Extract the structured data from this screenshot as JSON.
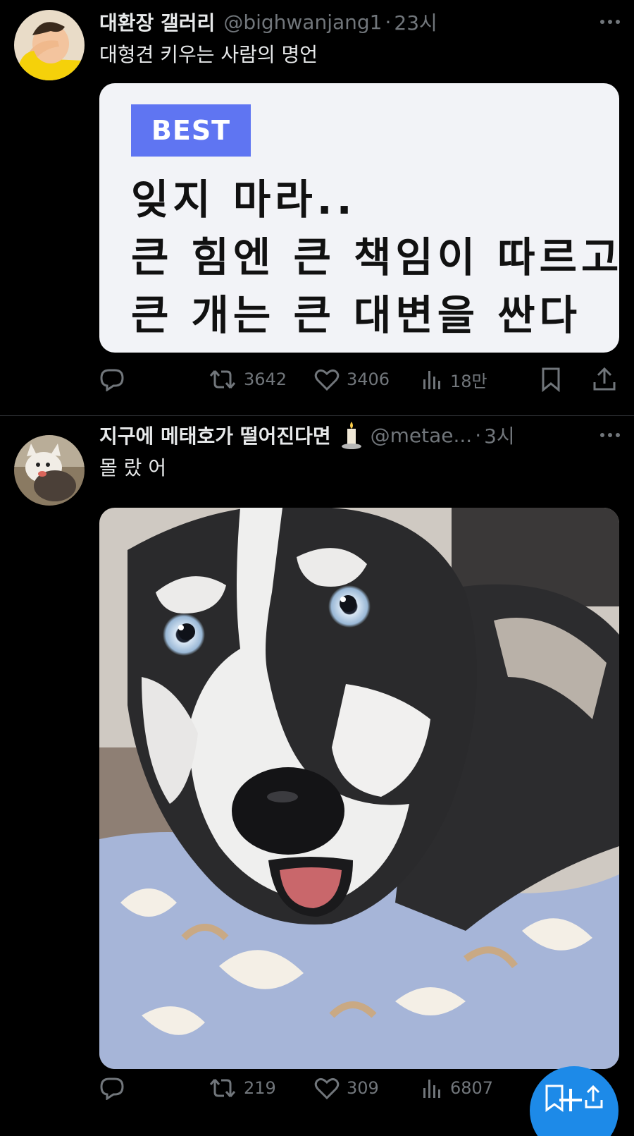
{
  "tweets": [
    {
      "display_name": "대환장 갤러리",
      "handle": "@bighwanjang1",
      "separator": "·",
      "time": "23시",
      "text": "대형견 키우는 사람의 명언",
      "media_card": {
        "badge": "BEST",
        "lines": [
          "잊지 마라..",
          "큰 힘엔 큰 책임이 따르고",
          "큰 개는 큰 대변을 싼다"
        ]
      },
      "stats": {
        "retweets": "3642",
        "likes": "3406",
        "views": "18만"
      }
    },
    {
      "display_name": "지구에 메태호가 떨어진다면",
      "name_emoji": "candle",
      "handle": "@metae...",
      "separator": "·",
      "time": "3시",
      "text": "몰 랐 어",
      "media_alt_icon": "husky-photo",
      "stats": {
        "retweets": "219",
        "likes": "309",
        "views": "6807"
      }
    }
  ],
  "fab": {
    "icon": "compose-plus-icon"
  },
  "colors": {
    "background": "#000000",
    "muted": "#71767b",
    "text": "#e7e9ea",
    "divider": "#2f3336",
    "best_badge": "#5f75f2",
    "fab": "#1d8ae8"
  }
}
